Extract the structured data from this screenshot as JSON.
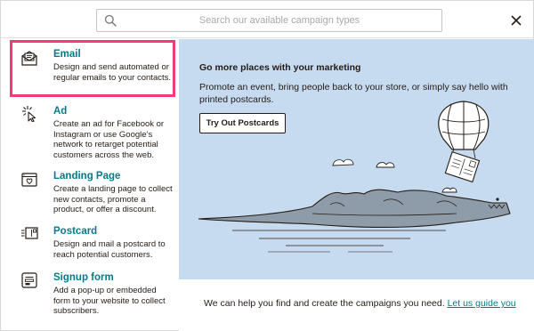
{
  "search": {
    "placeholder": "Search our available campaign types"
  },
  "campaign_types": [
    {
      "title": "Email",
      "description": "Design and send automated or regular emails to your contacts.",
      "icon": "email-icon"
    },
    {
      "title": "Ad",
      "description": "Create an ad for Facebook or Instagram or use Google’s network to retarget potential customers across the web.",
      "icon": "ad-icon"
    },
    {
      "title": "Landing Page",
      "description": "Create a landing page to collect new contacts, promote a product, or offer a discount.",
      "icon": "landing-page-icon"
    },
    {
      "title": "Postcard",
      "description": "Design and mail a postcard to reach potential customers.",
      "icon": "postcard-icon"
    },
    {
      "title": "Signup form",
      "description": "Add a pop-up or embedded form to your website to collect subscribers.",
      "icon": "signup-form-icon"
    }
  ],
  "promo": {
    "title": "Go more places with your marketing",
    "text": "Promote an event, bring people back to your store, or simply say hello with printed postcards.",
    "button_label": "Try Out Postcards"
  },
  "footer": {
    "text": "We can help you find and create the campaigns you need.",
    "link_label": "Let us guide you"
  },
  "colors": {
    "accent_teal": "#007c89",
    "highlight_pink": "#f2397a",
    "promo_background": "#c6daf0"
  }
}
